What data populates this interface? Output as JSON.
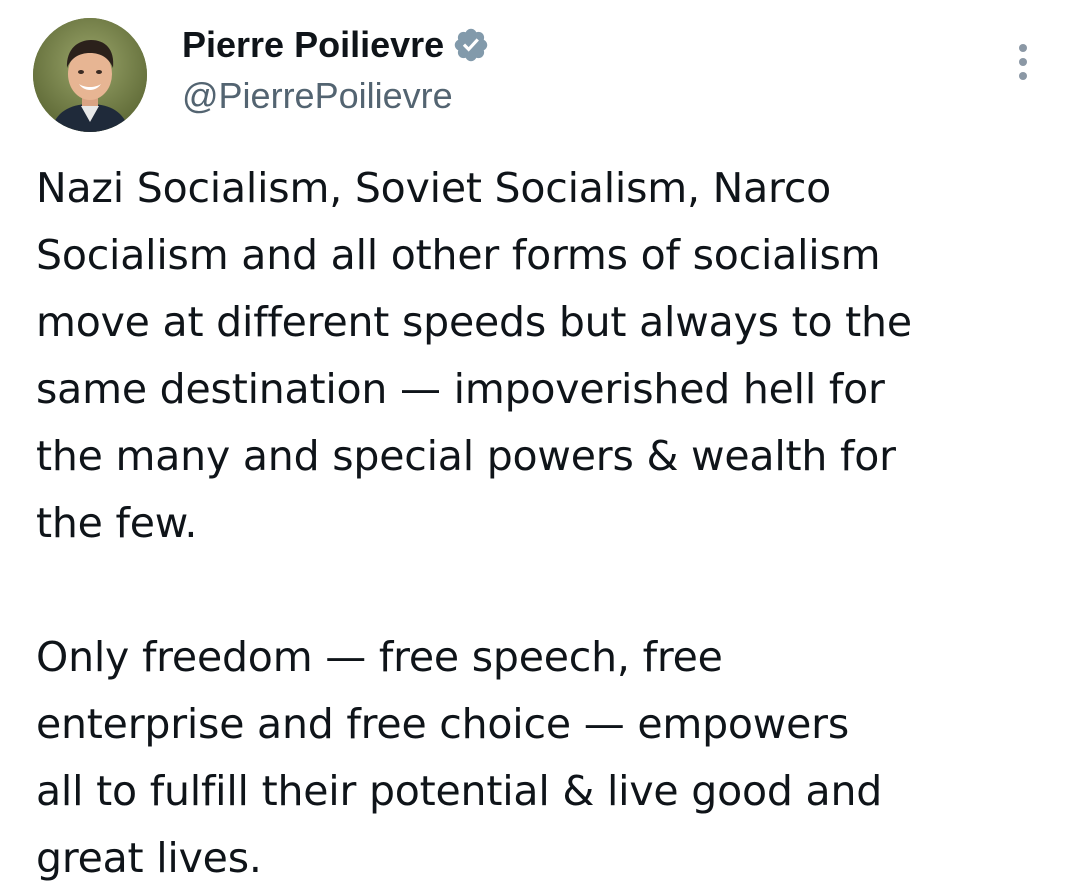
{
  "author": {
    "display_name": "Pierre Poilievre",
    "handle": "@PierrePoilievre",
    "verified_color": "#829aab"
  },
  "tweet": {
    "paragraph_1_lines": [
      "Nazi Socialism, Soviet Socialism, Narco",
      "Socialism and all other forms of socialism",
      "move at different speeds but always to the",
      "same destination — impoverished hell for",
      "the many and special powers & wealth for",
      "the few."
    ],
    "paragraph_2_lines": [
      "Only freedom — free speech, free",
      "enterprise and free choice — empowers",
      "all to fulfill their potential & live good and",
      "great lives."
    ]
  },
  "icons": {
    "verified": "verified-badge-icon",
    "more": "more-options-icon"
  },
  "colors": {
    "text_primary": "#0f1419",
    "text_secondary": "#536471",
    "background": "#ffffff"
  }
}
